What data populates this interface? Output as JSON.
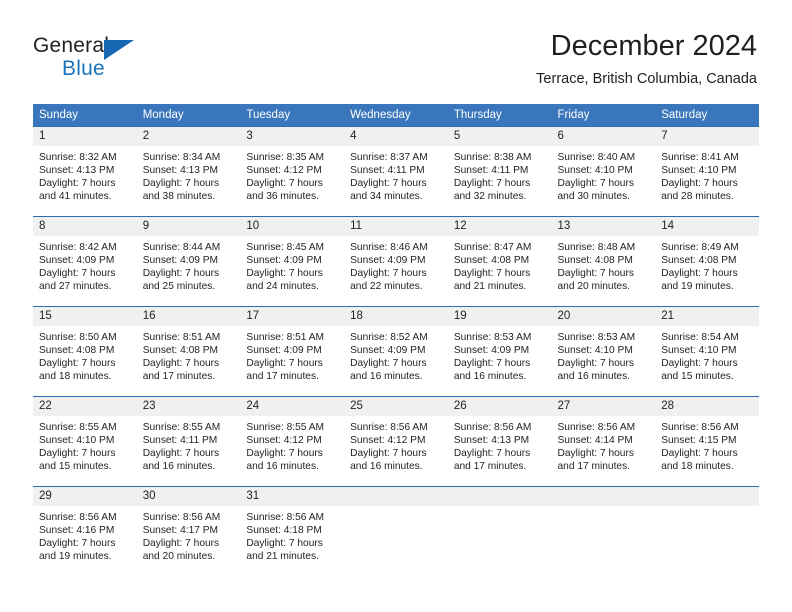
{
  "brand": {
    "word_one": "General",
    "word_two": "Blue",
    "flag_icon": "triangle-flag-icon",
    "accent_color": "#1b75bc"
  },
  "header": {
    "title": "December 2024",
    "subtitle": "Terrace, British Columbia, Canada"
  },
  "theme": {
    "header_bg": "#3a76bb",
    "header_text": "#ffffff",
    "row_rule": "#2e6cb0",
    "daynum_bg": "#f0f0f0",
    "body_text": "#231f20"
  },
  "weekday_headers": [
    "Sunday",
    "Monday",
    "Tuesday",
    "Wednesday",
    "Thursday",
    "Friday",
    "Saturday"
  ],
  "weeks": [
    [
      {
        "day": "1",
        "sunrise": "Sunrise: 8:32 AM",
        "sunset": "Sunset: 4:13 PM",
        "daylight_1": "Daylight: 7 hours",
        "daylight_2": "and 41 minutes."
      },
      {
        "day": "2",
        "sunrise": "Sunrise: 8:34 AM",
        "sunset": "Sunset: 4:13 PM",
        "daylight_1": "Daylight: 7 hours",
        "daylight_2": "and 38 minutes."
      },
      {
        "day": "3",
        "sunrise": "Sunrise: 8:35 AM",
        "sunset": "Sunset: 4:12 PM",
        "daylight_1": "Daylight: 7 hours",
        "daylight_2": "and 36 minutes."
      },
      {
        "day": "4",
        "sunrise": "Sunrise: 8:37 AM",
        "sunset": "Sunset: 4:11 PM",
        "daylight_1": "Daylight: 7 hours",
        "daylight_2": "and 34 minutes."
      },
      {
        "day": "5",
        "sunrise": "Sunrise: 8:38 AM",
        "sunset": "Sunset: 4:11 PM",
        "daylight_1": "Daylight: 7 hours",
        "daylight_2": "and 32 minutes."
      },
      {
        "day": "6",
        "sunrise": "Sunrise: 8:40 AM",
        "sunset": "Sunset: 4:10 PM",
        "daylight_1": "Daylight: 7 hours",
        "daylight_2": "and 30 minutes."
      },
      {
        "day": "7",
        "sunrise": "Sunrise: 8:41 AM",
        "sunset": "Sunset: 4:10 PM",
        "daylight_1": "Daylight: 7 hours",
        "daylight_2": "and 28 minutes."
      }
    ],
    [
      {
        "day": "8",
        "sunrise": "Sunrise: 8:42 AM",
        "sunset": "Sunset: 4:09 PM",
        "daylight_1": "Daylight: 7 hours",
        "daylight_2": "and 27 minutes."
      },
      {
        "day": "9",
        "sunrise": "Sunrise: 8:44 AM",
        "sunset": "Sunset: 4:09 PM",
        "daylight_1": "Daylight: 7 hours",
        "daylight_2": "and 25 minutes."
      },
      {
        "day": "10",
        "sunrise": "Sunrise: 8:45 AM",
        "sunset": "Sunset: 4:09 PM",
        "daylight_1": "Daylight: 7 hours",
        "daylight_2": "and 24 minutes."
      },
      {
        "day": "11",
        "sunrise": "Sunrise: 8:46 AM",
        "sunset": "Sunset: 4:09 PM",
        "daylight_1": "Daylight: 7 hours",
        "daylight_2": "and 22 minutes."
      },
      {
        "day": "12",
        "sunrise": "Sunrise: 8:47 AM",
        "sunset": "Sunset: 4:08 PM",
        "daylight_1": "Daylight: 7 hours",
        "daylight_2": "and 21 minutes."
      },
      {
        "day": "13",
        "sunrise": "Sunrise: 8:48 AM",
        "sunset": "Sunset: 4:08 PM",
        "daylight_1": "Daylight: 7 hours",
        "daylight_2": "and 20 minutes."
      },
      {
        "day": "14",
        "sunrise": "Sunrise: 8:49 AM",
        "sunset": "Sunset: 4:08 PM",
        "daylight_1": "Daylight: 7 hours",
        "daylight_2": "and 19 minutes."
      }
    ],
    [
      {
        "day": "15",
        "sunrise": "Sunrise: 8:50 AM",
        "sunset": "Sunset: 4:08 PM",
        "daylight_1": "Daylight: 7 hours",
        "daylight_2": "and 18 minutes."
      },
      {
        "day": "16",
        "sunrise": "Sunrise: 8:51 AM",
        "sunset": "Sunset: 4:08 PM",
        "daylight_1": "Daylight: 7 hours",
        "daylight_2": "and 17 minutes."
      },
      {
        "day": "17",
        "sunrise": "Sunrise: 8:51 AM",
        "sunset": "Sunset: 4:09 PM",
        "daylight_1": "Daylight: 7 hours",
        "daylight_2": "and 17 minutes."
      },
      {
        "day": "18",
        "sunrise": "Sunrise: 8:52 AM",
        "sunset": "Sunset: 4:09 PM",
        "daylight_1": "Daylight: 7 hours",
        "daylight_2": "and 16 minutes."
      },
      {
        "day": "19",
        "sunrise": "Sunrise: 8:53 AM",
        "sunset": "Sunset: 4:09 PM",
        "daylight_1": "Daylight: 7 hours",
        "daylight_2": "and 16 minutes."
      },
      {
        "day": "20",
        "sunrise": "Sunrise: 8:53 AM",
        "sunset": "Sunset: 4:10 PM",
        "daylight_1": "Daylight: 7 hours",
        "daylight_2": "and 16 minutes."
      },
      {
        "day": "21",
        "sunrise": "Sunrise: 8:54 AM",
        "sunset": "Sunset: 4:10 PM",
        "daylight_1": "Daylight: 7 hours",
        "daylight_2": "and 15 minutes."
      }
    ],
    [
      {
        "day": "22",
        "sunrise": "Sunrise: 8:55 AM",
        "sunset": "Sunset: 4:10 PM",
        "daylight_1": "Daylight: 7 hours",
        "daylight_2": "and 15 minutes."
      },
      {
        "day": "23",
        "sunrise": "Sunrise: 8:55 AM",
        "sunset": "Sunset: 4:11 PM",
        "daylight_1": "Daylight: 7 hours",
        "daylight_2": "and 16 minutes."
      },
      {
        "day": "24",
        "sunrise": "Sunrise: 8:55 AM",
        "sunset": "Sunset: 4:12 PM",
        "daylight_1": "Daylight: 7 hours",
        "daylight_2": "and 16 minutes."
      },
      {
        "day": "25",
        "sunrise": "Sunrise: 8:56 AM",
        "sunset": "Sunset: 4:12 PM",
        "daylight_1": "Daylight: 7 hours",
        "daylight_2": "and 16 minutes."
      },
      {
        "day": "26",
        "sunrise": "Sunrise: 8:56 AM",
        "sunset": "Sunset: 4:13 PM",
        "daylight_1": "Daylight: 7 hours",
        "daylight_2": "and 17 minutes."
      },
      {
        "day": "27",
        "sunrise": "Sunrise: 8:56 AM",
        "sunset": "Sunset: 4:14 PM",
        "daylight_1": "Daylight: 7 hours",
        "daylight_2": "and 17 minutes."
      },
      {
        "day": "28",
        "sunrise": "Sunrise: 8:56 AM",
        "sunset": "Sunset: 4:15 PM",
        "daylight_1": "Daylight: 7 hours",
        "daylight_2": "and 18 minutes."
      }
    ],
    [
      {
        "day": "29",
        "sunrise": "Sunrise: 8:56 AM",
        "sunset": "Sunset: 4:16 PM",
        "daylight_1": "Daylight: 7 hours",
        "daylight_2": "and 19 minutes."
      },
      {
        "day": "30",
        "sunrise": "Sunrise: 8:56 AM",
        "sunset": "Sunset: 4:17 PM",
        "daylight_1": "Daylight: 7 hours",
        "daylight_2": "and 20 minutes."
      },
      {
        "day": "31",
        "sunrise": "Sunrise: 8:56 AM",
        "sunset": "Sunset: 4:18 PM",
        "daylight_1": "Daylight: 7 hours",
        "daylight_2": "and 21 minutes."
      },
      {
        "day": "",
        "sunrise": "",
        "sunset": "",
        "daylight_1": "",
        "daylight_2": ""
      },
      {
        "day": "",
        "sunrise": "",
        "sunset": "",
        "daylight_1": "",
        "daylight_2": ""
      },
      {
        "day": "",
        "sunrise": "",
        "sunset": "",
        "daylight_1": "",
        "daylight_2": ""
      },
      {
        "day": "",
        "sunrise": "",
        "sunset": "",
        "daylight_1": "",
        "daylight_2": ""
      }
    ]
  ]
}
